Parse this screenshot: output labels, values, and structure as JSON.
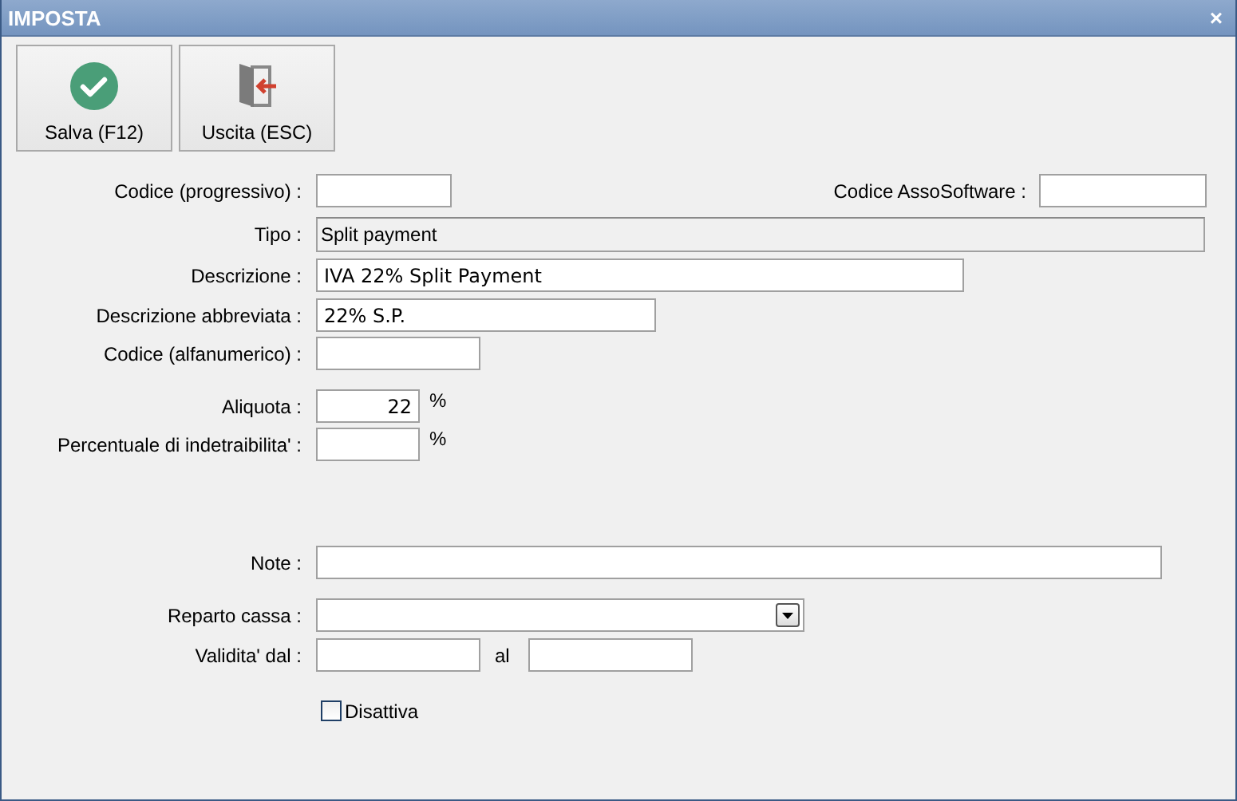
{
  "window": {
    "title": "IMPOSTA",
    "close": "×"
  },
  "toolbar": [
    {
      "label": "Salva (F12)",
      "kind": "save"
    },
    {
      "label": "Uscita (ESC)",
      "kind": "exit"
    }
  ],
  "codice_progressivo": {
    "label": "Codice (progressivo) :"
  },
  "codice_assosoftware": {
    "label": "Codice AssoSoftware :"
  },
  "tipo": {
    "label": "Tipo :",
    "value": "Split payment"
  },
  "descrizione": {
    "label": "Descrizione :",
    "value": "IVA 22% Split Payment"
  },
  "descrizione_abbreviata": {
    "label": "Descrizione abbreviata :",
    "value": "22% S.P."
  },
  "codice_alfanumerico": {
    "label": "Codice (alfanumerico) :"
  },
  "aliquota": {
    "label": "Aliquota :",
    "value": "22",
    "unit": "%"
  },
  "percentuale_indetraibilita": {
    "label": "Percentuale di indetraibilita' :",
    "unit": "%"
  },
  "note": {
    "label": "Note :"
  },
  "reparto_cassa": {
    "label": "Reparto cassa :"
  },
  "validita": {
    "label": "Validita' dal :",
    "between": "al"
  },
  "disattiva": {
    "label": "Disattiva",
    "checked": false
  }
}
